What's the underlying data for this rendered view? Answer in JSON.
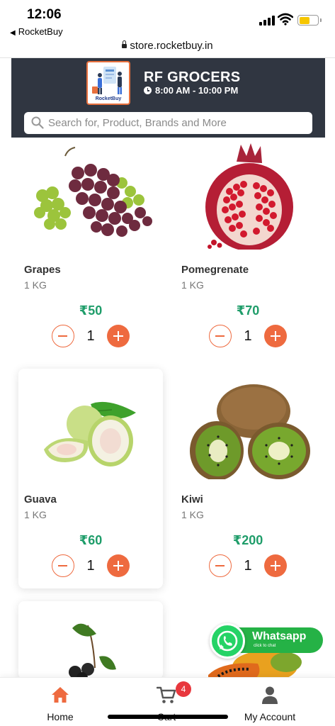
{
  "status_bar": {
    "time": "12:06",
    "back_app": "RocketBuy"
  },
  "browser": {
    "url": "store.rocketbuy.in"
  },
  "store": {
    "name": "RF GROCERS",
    "hours": "8:00 AM - 10:00 PM",
    "logo_text": "RocketBuy",
    "search_placeholder": "Search for, Product, Brands and More"
  },
  "products": [
    {
      "name": "Grapes",
      "unit": "1 KG",
      "price": "₹50",
      "qty": "1"
    },
    {
      "name": "Pomegrenate",
      "unit": "1 KG",
      "price": "₹70",
      "qty": "1"
    },
    {
      "name": "Guava",
      "unit": "1 KG",
      "price": "₹60",
      "qty": "1"
    },
    {
      "name": "Kiwi",
      "unit": "1 KG",
      "price": "₹200",
      "qty": "1"
    }
  ],
  "whatsapp": {
    "label": "Whatsapp",
    "sub": "click to chat"
  },
  "nav": {
    "home": "Home",
    "cart": "Cart",
    "cart_count": "4",
    "account": "My Account"
  },
  "colors": {
    "header": "#303641",
    "accent": "#ee6a3f",
    "price": "#1f9d6a",
    "whatsapp": "#25b246"
  }
}
